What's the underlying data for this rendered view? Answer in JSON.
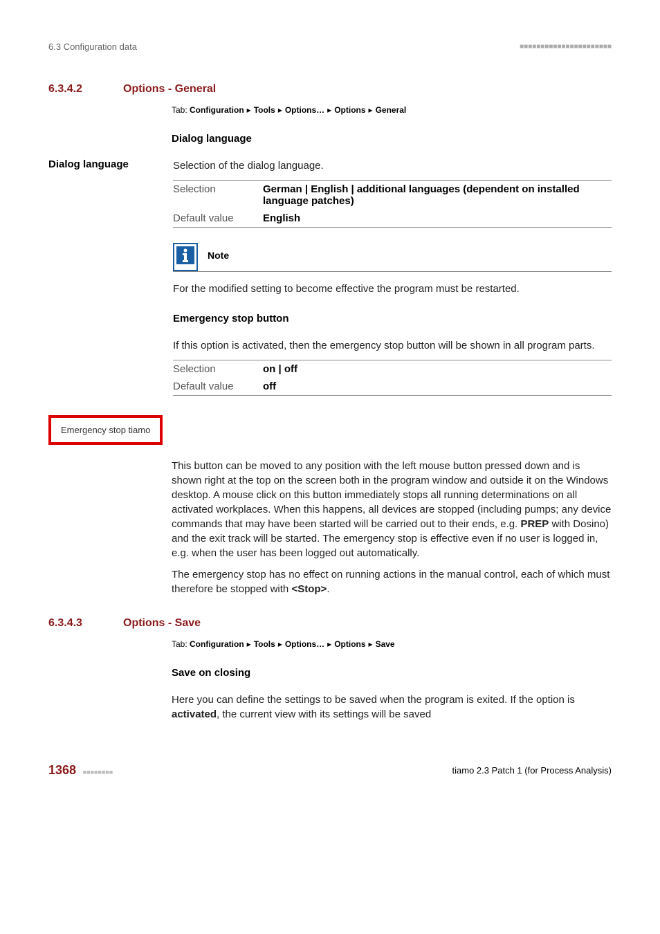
{
  "header": {
    "breadcrumb": "6.3 Configuration data",
    "dots": "■■■■■■■■■■■■■■■■■■■■■■"
  },
  "section_general": {
    "number": "6.3.4.2",
    "title": "Options - General",
    "tab_prefix": "Tab: ",
    "tab_parts": [
      "Configuration",
      "Tools",
      "Options…",
      "Options",
      "General"
    ],
    "dialog_heading": "Dialog language",
    "dialog_label": "Dialog language",
    "dialog_desc": "Selection of the dialog language.",
    "selection_label": "Selection",
    "selection_value": "German | English | additional languages (dependent on installed language patches)",
    "default_label": "Default value",
    "default_value": "English",
    "note_title": "Note",
    "note_body": "For the modified setting to become effective the program must be restarted.",
    "emerg_heading": "Emergency stop button",
    "emerg_desc": "If this option is activated, then the emergency stop button will be shown in all program parts.",
    "emerg_sel_label": "Selection",
    "emerg_sel_value": "on | off",
    "emerg_def_label": "Default value",
    "emerg_def_value": "off",
    "emerg_button_text": "Emergency stop tiamo",
    "emerg_para1_a": "This button can be moved to any position with the left mouse button pressed down and is shown right at the top on the screen both in the program window and outside it on the Windows desktop. A mouse click on this button immediately stops all running determinations on all activated workplaces. When this happens, all devices are stopped (including pumps; any device commands that may have been started will be carried out to their ends, e.g. ",
    "emerg_para1_bold": "PREP",
    "emerg_para1_b": " with Dosino) and the exit track will be started. The emergency stop is effective even if no user is logged in, e.g. when the user has been logged out automatically.",
    "emerg_para2_a": "The emergency stop has no effect on running actions in the manual control, each of which must therefore be stopped with ",
    "emerg_para2_bold": "<Stop>",
    "emerg_para2_b": "."
  },
  "section_save": {
    "number": "6.3.4.3",
    "title": "Options - Save",
    "tab_prefix": "Tab: ",
    "tab_parts": [
      "Configuration",
      "Tools",
      "Options…",
      "Options",
      "Save"
    ],
    "save_heading": "Save on closing",
    "save_desc_a": "Here you can define the settings to be saved when the program is exited. If the option is ",
    "save_desc_bold": "activated",
    "save_desc_b": ", the current view with its settings will be saved"
  },
  "footer": {
    "page": "1368",
    "mini_dots": "■■■■■■■■",
    "right": "tiamo 2.3 Patch 1 (for Process Analysis)"
  }
}
